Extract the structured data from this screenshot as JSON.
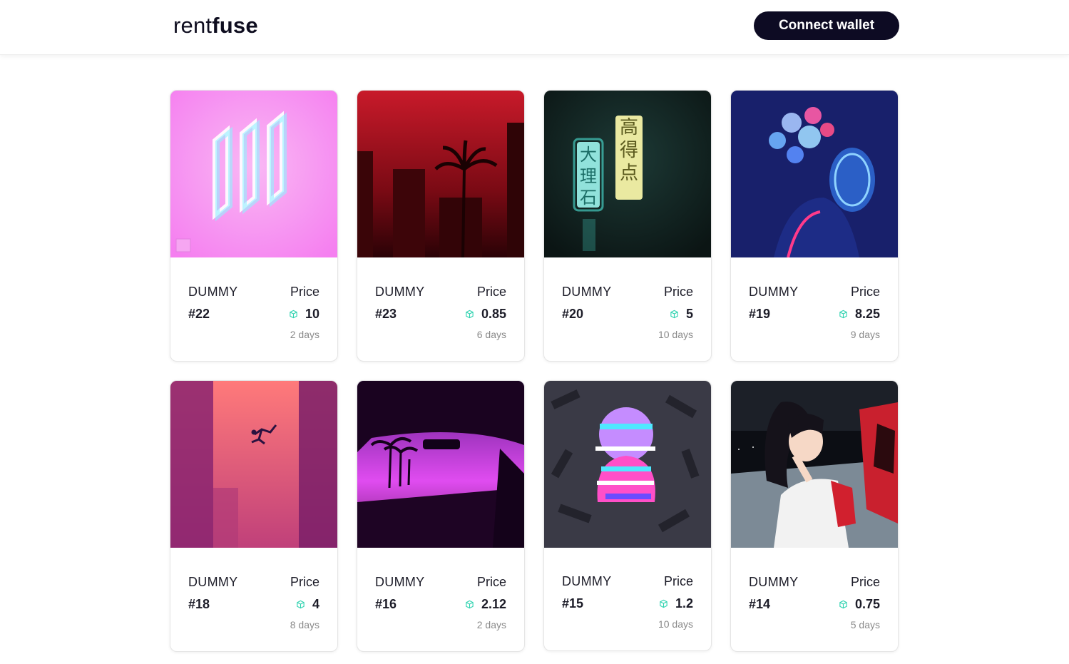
{
  "header": {
    "logo_light": "rent",
    "logo_bold": "fuse",
    "connect_label": "Connect wallet"
  },
  "colors": {
    "accent_dark": "#0d0b23",
    "token_teal": "#2fd3b0"
  },
  "cards": [
    {
      "name": "DUMMY",
      "id": "#22",
      "price_label": "Price",
      "price": "10",
      "duration": "2 days",
      "art": "pink-glitch-logo"
    },
    {
      "name": "DUMMY",
      "id": "#23",
      "price_label": "Price",
      "price": "0.85",
      "duration": "6 days",
      "art": "red-palm-city"
    },
    {
      "name": "DUMMY",
      "id": "#20",
      "price_label": "Price",
      "price": "5",
      "duration": "10 days",
      "art": "neon-signs"
    },
    {
      "name": "DUMMY",
      "id": "#19",
      "price_label": "Price",
      "price": "8.25",
      "duration": "9 days",
      "art": "blue-face-flower"
    },
    {
      "name": "DUMMY",
      "id": "#18",
      "price_label": "Price",
      "price": "4",
      "duration": "8 days",
      "art": "falling-figure"
    },
    {
      "name": "DUMMY",
      "id": "#16",
      "price_label": "Price",
      "price": "2.12",
      "duration": "2 days",
      "art": "car-sunset"
    },
    {
      "name": "DUMMY",
      "id": "#15",
      "price_label": "Price",
      "price": "1.2",
      "duration": "10 days",
      "art": "glitch-silhouette"
    },
    {
      "name": "DUMMY",
      "id": "#14",
      "price_label": "Price",
      "price": "0.75",
      "duration": "5 days",
      "art": "anime-girl-car"
    }
  ]
}
